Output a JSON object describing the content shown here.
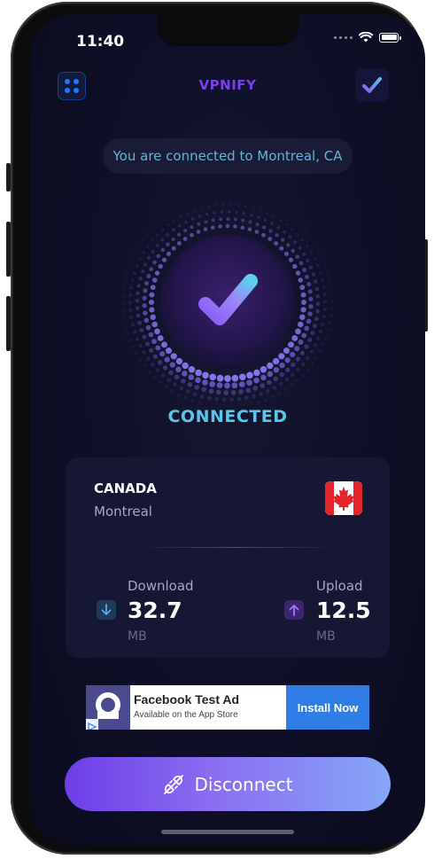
{
  "status_bar": {
    "time": "11:40"
  },
  "header": {
    "title": "VPNIFY"
  },
  "connection": {
    "message": "You are connected to Montreal, CA",
    "status": "CONNECTED"
  },
  "location": {
    "country": "CANADA",
    "city": "Montreal"
  },
  "stats": {
    "download": {
      "label": "Download",
      "value": "32.7",
      "unit": "MB"
    },
    "upload": {
      "label": "Upload",
      "value": "12.5",
      "unit": "MB"
    }
  },
  "ad": {
    "title": "Facebook Test Ad",
    "subtitle": "Available on the App Store",
    "cta": "Install Now"
  },
  "actions": {
    "disconnect_label": "Disconnect"
  },
  "colors": {
    "background": "#0f1028",
    "accent_purple": "#7b3ff0",
    "status_cyan": "#5cc6e8",
    "download_accent": "#5aa8e0",
    "upload_accent": "#8b5cf6",
    "button_gradient_start": "#6d3ee8",
    "button_gradient_end": "#86a6f8"
  },
  "icons": {
    "menu": "grid-dots-icon",
    "premium": "check-badge-icon",
    "shield": "checkmark-icon",
    "download": "arrow-down-icon",
    "upload": "arrow-up-icon",
    "disconnect": "plug-off-icon"
  }
}
